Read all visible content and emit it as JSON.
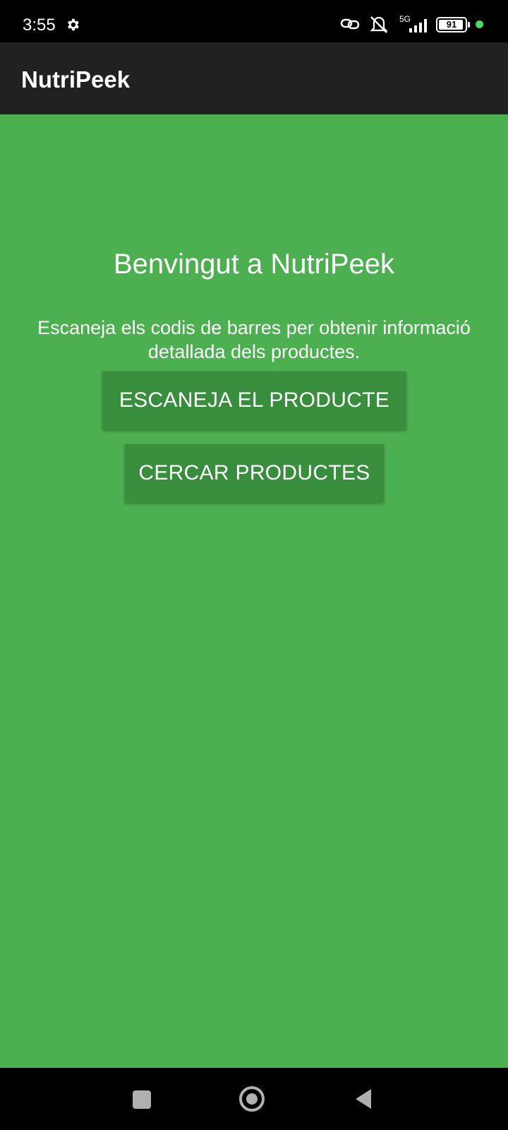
{
  "status_bar": {
    "time": "3:55",
    "battery": "91",
    "network": "5G",
    "icons": [
      "gear-icon",
      "link-icon",
      "mute-icon",
      "signal-icon",
      "battery-icon",
      "dot-icon"
    ]
  },
  "app_bar": {
    "title": "NutriPeek"
  },
  "main": {
    "welcome": "Benvingut a NutriPeek",
    "subtitle": "Escaneja els codis de barres per obtenir informació detallada dels productes.",
    "scan_button": "ESCANEJA EL PRODUCTE",
    "search_button": "CERCAR PRODUCTES"
  },
  "nav_bar": {
    "icons": [
      "recents-icon",
      "home-icon",
      "back-icon"
    ]
  },
  "colors": {
    "background": "#4caf50",
    "button": "#388e3c",
    "app_bar": "#212121",
    "status_dot": "#4cd964"
  }
}
